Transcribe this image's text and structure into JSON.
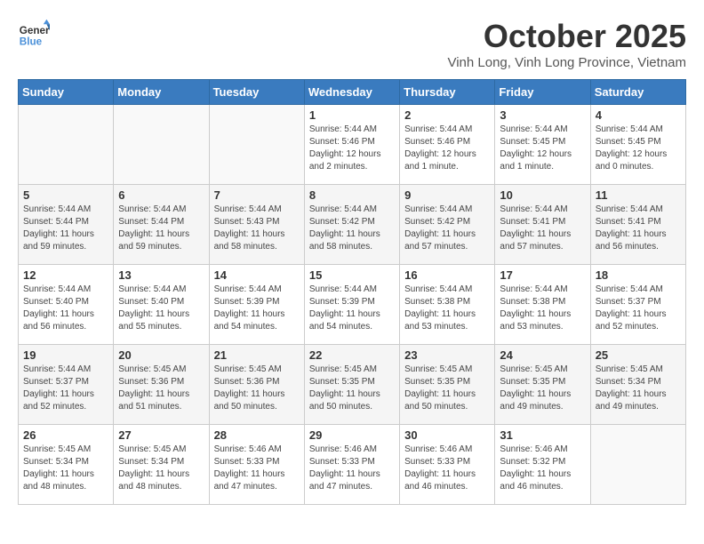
{
  "header": {
    "logo_line1": "General",
    "logo_line2": "Blue",
    "month_title": "October 2025",
    "subtitle": "Vinh Long, Vinh Long Province, Vietnam"
  },
  "days_of_week": [
    "Sunday",
    "Monday",
    "Tuesday",
    "Wednesday",
    "Thursday",
    "Friday",
    "Saturday"
  ],
  "weeks": [
    [
      {
        "day": "",
        "info": ""
      },
      {
        "day": "",
        "info": ""
      },
      {
        "day": "",
        "info": ""
      },
      {
        "day": "1",
        "info": "Sunrise: 5:44 AM\nSunset: 5:46 PM\nDaylight: 12 hours\nand 2 minutes."
      },
      {
        "day": "2",
        "info": "Sunrise: 5:44 AM\nSunset: 5:46 PM\nDaylight: 12 hours\nand 1 minute."
      },
      {
        "day": "3",
        "info": "Sunrise: 5:44 AM\nSunset: 5:45 PM\nDaylight: 12 hours\nand 1 minute."
      },
      {
        "day": "4",
        "info": "Sunrise: 5:44 AM\nSunset: 5:45 PM\nDaylight: 12 hours\nand 0 minutes."
      }
    ],
    [
      {
        "day": "5",
        "info": "Sunrise: 5:44 AM\nSunset: 5:44 PM\nDaylight: 11 hours\nand 59 minutes."
      },
      {
        "day": "6",
        "info": "Sunrise: 5:44 AM\nSunset: 5:44 PM\nDaylight: 11 hours\nand 59 minutes."
      },
      {
        "day": "7",
        "info": "Sunrise: 5:44 AM\nSunset: 5:43 PM\nDaylight: 11 hours\nand 58 minutes."
      },
      {
        "day": "8",
        "info": "Sunrise: 5:44 AM\nSunset: 5:42 PM\nDaylight: 11 hours\nand 58 minutes."
      },
      {
        "day": "9",
        "info": "Sunrise: 5:44 AM\nSunset: 5:42 PM\nDaylight: 11 hours\nand 57 minutes."
      },
      {
        "day": "10",
        "info": "Sunrise: 5:44 AM\nSunset: 5:41 PM\nDaylight: 11 hours\nand 57 minutes."
      },
      {
        "day": "11",
        "info": "Sunrise: 5:44 AM\nSunset: 5:41 PM\nDaylight: 11 hours\nand 56 minutes."
      }
    ],
    [
      {
        "day": "12",
        "info": "Sunrise: 5:44 AM\nSunset: 5:40 PM\nDaylight: 11 hours\nand 56 minutes."
      },
      {
        "day": "13",
        "info": "Sunrise: 5:44 AM\nSunset: 5:40 PM\nDaylight: 11 hours\nand 55 minutes."
      },
      {
        "day": "14",
        "info": "Sunrise: 5:44 AM\nSunset: 5:39 PM\nDaylight: 11 hours\nand 54 minutes."
      },
      {
        "day": "15",
        "info": "Sunrise: 5:44 AM\nSunset: 5:39 PM\nDaylight: 11 hours\nand 54 minutes."
      },
      {
        "day": "16",
        "info": "Sunrise: 5:44 AM\nSunset: 5:38 PM\nDaylight: 11 hours\nand 53 minutes."
      },
      {
        "day": "17",
        "info": "Sunrise: 5:44 AM\nSunset: 5:38 PM\nDaylight: 11 hours\nand 53 minutes."
      },
      {
        "day": "18",
        "info": "Sunrise: 5:44 AM\nSunset: 5:37 PM\nDaylight: 11 hours\nand 52 minutes."
      }
    ],
    [
      {
        "day": "19",
        "info": "Sunrise: 5:44 AM\nSunset: 5:37 PM\nDaylight: 11 hours\nand 52 minutes."
      },
      {
        "day": "20",
        "info": "Sunrise: 5:45 AM\nSunset: 5:36 PM\nDaylight: 11 hours\nand 51 minutes."
      },
      {
        "day": "21",
        "info": "Sunrise: 5:45 AM\nSunset: 5:36 PM\nDaylight: 11 hours\nand 50 minutes."
      },
      {
        "day": "22",
        "info": "Sunrise: 5:45 AM\nSunset: 5:35 PM\nDaylight: 11 hours\nand 50 minutes."
      },
      {
        "day": "23",
        "info": "Sunrise: 5:45 AM\nSunset: 5:35 PM\nDaylight: 11 hours\nand 50 minutes."
      },
      {
        "day": "24",
        "info": "Sunrise: 5:45 AM\nSunset: 5:35 PM\nDaylight: 11 hours\nand 49 minutes."
      },
      {
        "day": "25",
        "info": "Sunrise: 5:45 AM\nSunset: 5:34 PM\nDaylight: 11 hours\nand 49 minutes."
      }
    ],
    [
      {
        "day": "26",
        "info": "Sunrise: 5:45 AM\nSunset: 5:34 PM\nDaylight: 11 hours\nand 48 minutes."
      },
      {
        "day": "27",
        "info": "Sunrise: 5:45 AM\nSunset: 5:34 PM\nDaylight: 11 hours\nand 48 minutes."
      },
      {
        "day": "28",
        "info": "Sunrise: 5:46 AM\nSunset: 5:33 PM\nDaylight: 11 hours\nand 47 minutes."
      },
      {
        "day": "29",
        "info": "Sunrise: 5:46 AM\nSunset: 5:33 PM\nDaylight: 11 hours\nand 47 minutes."
      },
      {
        "day": "30",
        "info": "Sunrise: 5:46 AM\nSunset: 5:33 PM\nDaylight: 11 hours\nand 46 minutes."
      },
      {
        "day": "31",
        "info": "Sunrise: 5:46 AM\nSunset: 5:32 PM\nDaylight: 11 hours\nand 46 minutes."
      },
      {
        "day": "",
        "info": ""
      }
    ]
  ]
}
